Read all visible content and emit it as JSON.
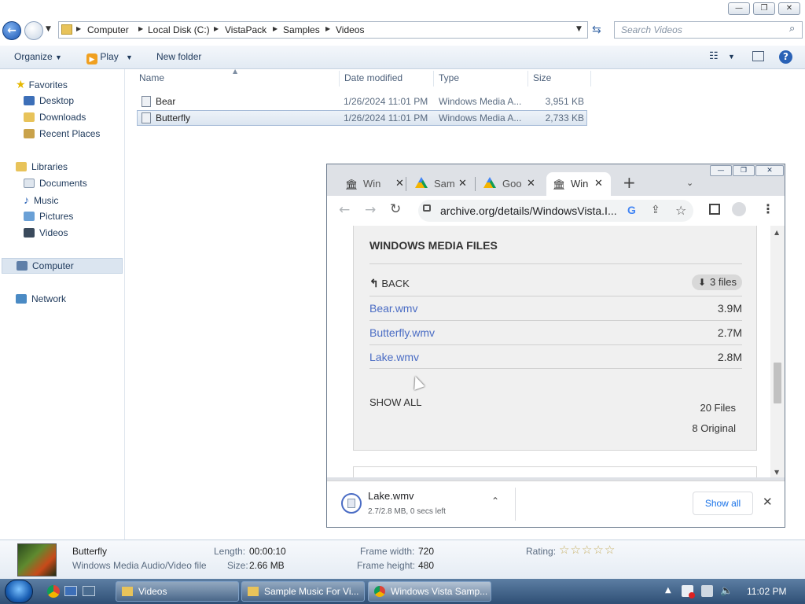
{
  "explorer": {
    "breadcrumb": [
      "Computer",
      "Local Disk (C:)",
      "VistaPack",
      "Samples",
      "Videos"
    ],
    "search_placeholder": "Search Videos",
    "toolbar": {
      "organize": "Organize",
      "play": "Play",
      "new_folder": "New folder"
    },
    "nav": {
      "favorites": "Favorites",
      "favorites_items": [
        "Desktop",
        "Downloads",
        "Recent Places"
      ],
      "libraries": "Libraries",
      "libraries_items": [
        "Documents",
        "Music",
        "Pictures",
        "Videos"
      ],
      "computer": "Computer",
      "network": "Network"
    },
    "columns": {
      "name": "Name",
      "date": "Date modified",
      "type": "Type",
      "size": "Size"
    },
    "files": [
      {
        "name": "Bear",
        "date": "1/26/2024 11:01 PM",
        "type": "Windows Media A...",
        "size": "3,951 KB"
      },
      {
        "name": "Butterfly",
        "date": "1/26/2024 11:01 PM",
        "type": "Windows Media A...",
        "size": "2,733 KB"
      }
    ],
    "details": {
      "name": "Butterfly",
      "kind": "Windows Media Audio/Video file",
      "length_label": "Length:",
      "length": "00:00:10",
      "size_label": "Size:",
      "size": "2.66 MB",
      "frame_width_label": "Frame width:",
      "frame_width": "720",
      "frame_height_label": "Frame height:",
      "frame_height": "480",
      "rating_label": "Rating:",
      "rating_stars": 5
    }
  },
  "chrome": {
    "tabs": [
      "Win",
      "Sam",
      "Goo",
      "Win"
    ],
    "new_tab": "+",
    "url": "archive.org/details/WindowsVista.I...",
    "section_title": "WINDOWS MEDIA FILES",
    "back": "BACK",
    "files_badge": "3 files",
    "files": [
      {
        "name": "Bear.wmv",
        "size": "3.9M"
      },
      {
        "name": "Butterfly.wmv",
        "size": "2.7M"
      },
      {
        "name": "Lake.wmv",
        "size": "2.8M"
      }
    ],
    "show_all_link": "SHOW ALL",
    "total_files": "20 Files",
    "original": "8 Original",
    "download": {
      "filename": "Lake.wmv",
      "status": "2.7/2.8 MB, 0 secs left",
      "show_all": "Show all"
    }
  },
  "taskbar": {
    "buttons": [
      "Videos",
      "Sample Music For Vi...",
      "Windows Vista Samp..."
    ],
    "clock": "11:02 PM"
  },
  "colors": {
    "accent": "#1b56b3",
    "link": "#4a6cc4",
    "taskbar": "#2f4f75"
  }
}
